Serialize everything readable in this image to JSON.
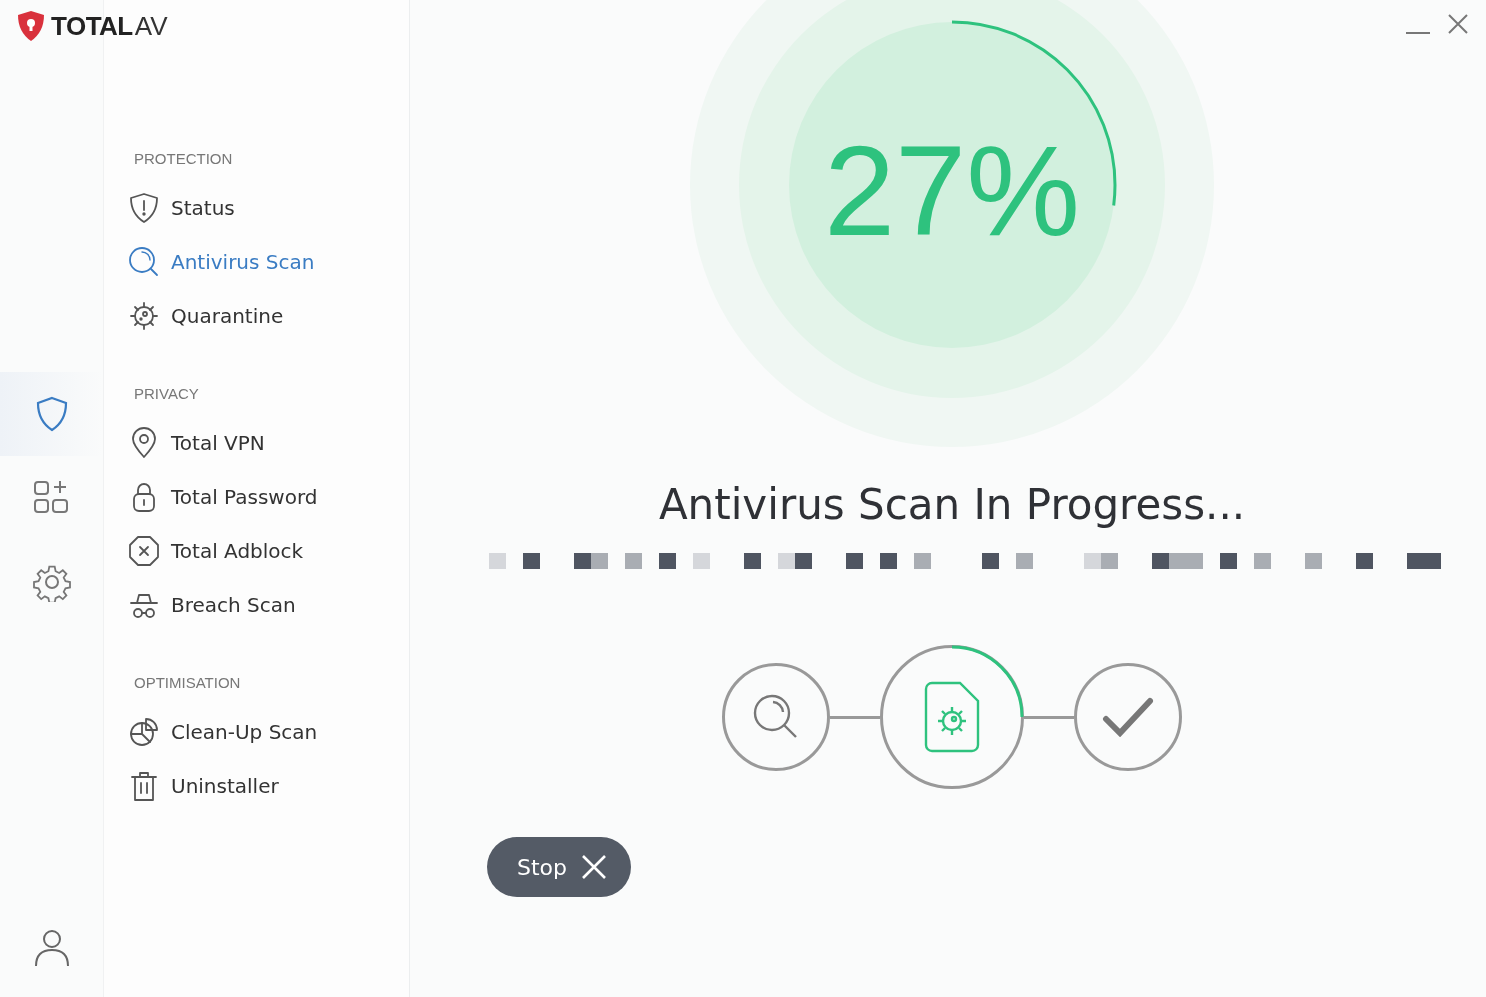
{
  "logo": {
    "brand": "TOTAL",
    "suffix": "AV"
  },
  "rail": [
    {
      "kind": "shield",
      "selected": true
    },
    {
      "kind": "apps",
      "selected": false
    },
    {
      "kind": "settings",
      "selected": false
    }
  ],
  "nav": [
    {
      "heading": "PROTECTION",
      "items": [
        {
          "label": "Status",
          "kind": "shield-alert",
          "selected": false
        },
        {
          "label": "Antivirus Scan",
          "kind": "search",
          "selected": true
        },
        {
          "label": "Quarantine",
          "kind": "virus",
          "selected": false
        }
      ]
    },
    {
      "heading": "PRIVACY",
      "items": [
        {
          "label": "Total VPN",
          "kind": "pin",
          "selected": false
        },
        {
          "label": "Total Password",
          "kind": "lock",
          "selected": false
        },
        {
          "label": "Total Adblock",
          "kind": "block",
          "selected": false
        },
        {
          "label": "Breach Scan",
          "kind": "spy",
          "selected": false
        }
      ]
    },
    {
      "heading": "OPTIMISATION",
      "items": [
        {
          "label": "Clean-Up Scan",
          "kind": "pie",
          "selected": false
        },
        {
          "label": "Uninstaller",
          "kind": "trash",
          "selected": false
        }
      ]
    }
  ],
  "scan": {
    "percent": "27%",
    "level": 0.27,
    "title": "Antivirus Scan In Progress...",
    "steps": [
      {
        "kind": "search",
        "selected": false
      },
      {
        "kind": "file",
        "selected": true
      },
      {
        "kind": "check",
        "selected": false
      }
    ],
    "stop_button": {
      "label": "Stop"
    }
  }
}
